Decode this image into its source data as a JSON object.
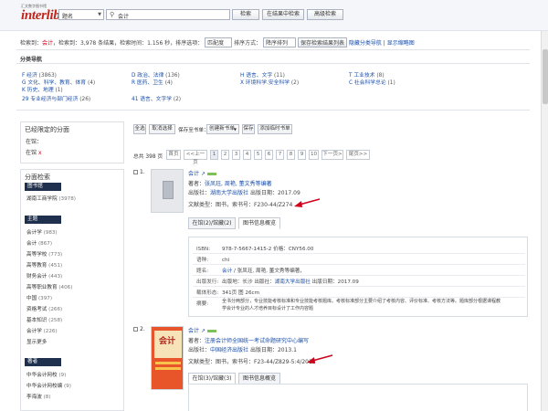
{
  "header": {
    "logo_sub": "汇文数字图书馆",
    "logo": "interlib",
    "field_select": "题名",
    "search_value": "会计",
    "buttons": {
      "search": "检索",
      "in_results": "在结果中检索",
      "advanced": "高级检索"
    }
  },
  "status": {
    "prefix": "检索到：",
    "term": "会计",
    "summary": "，检索到：3,978 条结果，检索时间：1.156 秒，排序选项：",
    "sort_option": "匹配度",
    "sort_way_label": "排序方式：",
    "sort_way": "降序排列",
    "save_button": "保存检索结果列表",
    "hide_nav": "隐藏分类导航",
    "show_thumb": "显示缩略图"
  },
  "nav": {
    "title": "分类导航",
    "items": [
      {
        "label": "F 经济",
        "count": "(3863)"
      },
      {
        "label": "D 政治、法律",
        "count": "(136)"
      },
      {
        "label": "H 语言、文字",
        "count": "(11)"
      },
      {
        "label": "T 工业技术",
        "count": "(8)"
      },
      {
        "label": "G 文化、科学、教育、体育",
        "count": "(4)"
      },
      {
        "label": "R 医药、卫生",
        "count": "(4)"
      },
      {
        "label": "X 环境科学.安全科学",
        "count": "(2)"
      },
      {
        "label": "C 社会科学总论",
        "count": "(1)"
      },
      {
        "label": "K 历史、地理",
        "count": "(1)"
      },
      {
        "label": "29 专业经济与部门经济",
        "count": "(26)"
      },
      {
        "label": "41 语言、文字学",
        "count": "(2)"
      }
    ]
  },
  "left": {
    "limited_title": "已经限定的分面",
    "in_label": "在馆：",
    "in_value": "在馆",
    "in_x": "x",
    "facet_title": "分面检索",
    "library_cap": "图书馆",
    "library_items": [
      {
        "label": "湖南工商学院",
        "count": "(3978)"
      }
    ],
    "subject_cap": "主题",
    "subject_items": [
      {
        "label": "会计学",
        "count": "(983)"
      },
      {
        "label": "会计",
        "count": "(867)"
      },
      {
        "label": "高等学校",
        "count": "(773)"
      },
      {
        "label": "高等教育",
        "count": "(451)"
      },
      {
        "label": "财务会计",
        "count": "(443)"
      },
      {
        "label": "高等职业教育",
        "count": "(406)"
      },
      {
        "label": "中国",
        "count": "(397)"
      },
      {
        "label": "资格考试",
        "count": "(266)"
      },
      {
        "label": "基本知识",
        "count": "(258)"
      },
      {
        "label": "会计学",
        "count": "(226)"
      },
      {
        "label": "显示更多",
        "count": ""
      }
    ],
    "author_cap": "著者",
    "author_items": [
      {
        "label": "中华会计网校",
        "count": "(9)"
      },
      {
        "label": "中华会计网校编",
        "count": "(9)"
      },
      {
        "label": "李海波",
        "count": "(8)"
      }
    ]
  },
  "toolbar": {
    "select_all": "全选",
    "cancel_select": "取消选择",
    "save_to_list": "保存至书单：",
    "new_list": "创建新书单",
    "save": "保存",
    "add_temp": "添加临时书单"
  },
  "pager": {
    "total": "总共 398 页",
    "first": "首页",
    "prev": "<<上一页",
    "pages": [
      "1",
      "2",
      "3",
      "4",
      "5",
      "6",
      "7",
      "8",
      "9",
      "10"
    ],
    "next": "下一页>",
    "last": "尾页>>"
  },
  "results": [
    {
      "num": "1.",
      "title": "会计",
      "author_label": "著者：",
      "author": "张凤珏, 周艳, 董文秀等编著",
      "publisher_label": "出版社：",
      "publisher": "湖南大学出版社",
      "date_label": "出版日期：",
      "date": "2017.09",
      "type_label": "文献类型：",
      "type": "图书，索书号：",
      "callno": "F230-44/Z274",
      "tab_holdings": "在馆(2)/馆藏(2)",
      "tab_info": "图书信息概览",
      "detail": {
        "isbn_k": "ISBN:",
        "isbn": "978-7-5667-1415-2 价格：CNY56.00",
        "lang_k": "语种:",
        "lang": "chi",
        "author_k": "题名:",
        "author_pre": "会计",
        "author_post": " / 张凤珏, 周艳, 董文秀等编著，",
        "pub_k": "出版发行:",
        "pub_pre": "出版地：长沙 出版社：",
        "pub_name": "湖南大学出版社",
        "pub_post": " 出版日期：2017.09",
        "phys_k": "载体形态:",
        "phys": "341页 图 26cm",
        "abs_k": "摘要:",
        "abs1": "全书分两部分，专业技能考核标准和专业技能考核题库。考核标准部分主要介绍了考核内容、评价标准、考核方法等。题库部分根据课程教",
        "abs2": "学会计专业的人才培养目标设计了工作内容题"
      }
    },
    {
      "num": "2.",
      "title": "会计",
      "author_label": "著者：",
      "author": "注册会计师全国统一考试命题研究中心编写",
      "publisher_label": "出版社：",
      "publisher": "中国经济出版社",
      "date_label": "出版日期：",
      "date": "2013.1",
      "type_label": "文献类型：",
      "type": "图书，索书号：",
      "callno": "F23-44/Z829-5:4/2013",
      "tab_holdings": "在馆(3)/馆藏(3)",
      "tab_info": "图书信息概览",
      "cover_text": "会计"
    }
  ],
  "colors": {
    "accent": "#1a4ea8",
    "red": "#d0021b",
    "dark": "#1f2f4e"
  }
}
